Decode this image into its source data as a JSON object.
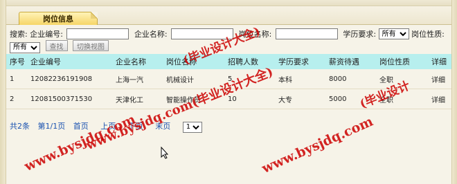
{
  "tab": {
    "title": "岗位信息"
  },
  "search": {
    "label": "搜索:",
    "company_no_label": "企业编号:",
    "company_name_label": "企业名称:",
    "job_name_label": "岗位名称:",
    "education_label": "学历要求:",
    "education_value": "所有",
    "job_nature_label": "岗位性质:",
    "job_nature_value": "所有",
    "search_button": "查找",
    "switch_view_button": "切换视图"
  },
  "table": {
    "headers": [
      "序号",
      "企业编号",
      "企业名称",
      "岗位名称",
      "招聘人数",
      "学历要求",
      "薪资待遇",
      "岗位性质",
      "详细"
    ],
    "rows": [
      [
        "1",
        "12082236191908",
        "上海一汽",
        "机械设计",
        "5",
        "本科",
        "8000",
        "全职",
        "详细"
      ],
      [
        "2",
        "12081500371530",
        "天津化工",
        "智能操作员",
        "10",
        "大专",
        "5000",
        "全职",
        "详细"
      ]
    ]
  },
  "pager": {
    "total": "共2条",
    "page_info": "第1/1页",
    "first": "首页",
    "prev": "上页",
    "next": "下页",
    "last": "末页",
    "page_select": "1"
  },
  "watermarks": {
    "url": "www.bysjdq.com",
    "site": "www.bysjdq.com(毕业设计大全)",
    "brand": "(毕业设计大全)",
    "partial": "(毕业设计"
  },
  "colors": {
    "header_bg": "#b7efee",
    "link": "#1a52b0",
    "watermark": "#cc0000",
    "tab": "#f5d25e"
  }
}
